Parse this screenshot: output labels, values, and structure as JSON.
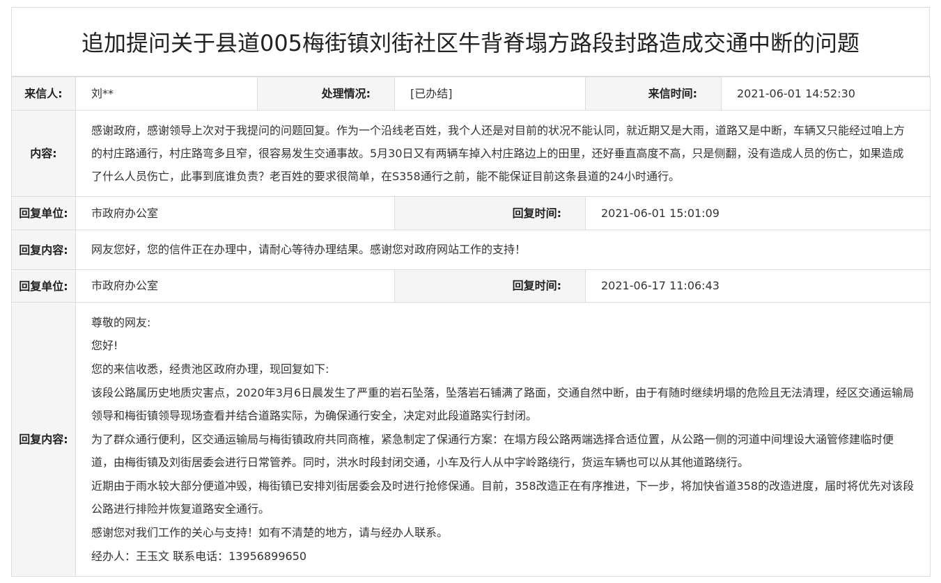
{
  "title": "追加提问关于县道005梅街镇刘街社区牛背脊塌方路段封路造成交通中断的问题",
  "row1": {
    "sender_label": "来信人:",
    "sender_value": "刘**",
    "status_label": "处理情况:",
    "status_value": "[已办结]",
    "time_label": "来信时间:",
    "time_value": "2021-06-01 14:52:30"
  },
  "content": {
    "label": "内容:",
    "text": "感谢政府，感谢领导上次对于我提问的问题回复。作为一个沿线老百姓，我个人还是对目前的状况不能认同，就近期又是大雨，道路又是中断，车辆又只能经过咱上方的村庄路通行，村庄路弯多且窄，很容易发生交通事故。5月30日又有两辆车掉入村庄路边上的田里，还好垂直高度不高，只是侧翻，没有造成人员的伤亡，如果造成了什么人员伤亡，此事到底谁负责？老百姓的要求很简单，在S358通行之前，能不能保证目前这条县道的24小时通行。"
  },
  "reply1": {
    "unit_label": "回复单位:",
    "unit_value": "市政府办公室",
    "time_label": "回复时间:",
    "time_value": "2021-06-01 15:01:09",
    "content_label": "回复内容:",
    "content_text": "网友您好，您的信件正在办理中，请耐心等待办理结果。感谢您对政府网站工作的支持！"
  },
  "reply2": {
    "unit_label": "回复单位:",
    "unit_value": "市政府办公室",
    "time_label": "回复时间:",
    "time_value": "2021-06-17 11:06:43",
    "content_label": "回复内容:",
    "paragraphs": [
      "尊敬的网友:",
      "您好!",
      "您的来信收悉，经贵池区政府办理，现回复如下:",
      "该段公路属历史地质灾害点，2020年3月6日晨发生了严重的岩石坠落，坠落岩石铺满了路面，交通自然中断，由于有随时继续坍塌的危险且无法清理，经区交通运输局领导和梅街镇领导现场查看并结合道路实际，为确保通行安全，决定对此段道路实行封闭。",
      "为了群众通行便利，区交通运输局与梅街镇政府共同商榷，紧急制定了保通行方案：在塌方段公路两端选择合适位置，从公路一侧的河道中间埋设大涵管修建临时便道，由梅街镇及刘街居委会进行日常管养。同时，洪水时段封闭交通，小车及行人从中字岭路绕行，货运车辆也可以从其他道路绕行。",
      "近期由于雨水较大部分便道冲毁，梅街镇已安排刘街居委会及时进行抢修保通。目前，358改造正在有序推进，下一步，将加快省道358的改造进度，届时将优先对该段公路进行排险并恢复道路安全通行。",
      "感谢您对我们工作的关心与支持！如有不清楚的地方，请与经办人联系。",
      "经办人：王玉文 联系电话：13956899650"
    ]
  },
  "colors": {
    "status_green": "#4caf50",
    "border": "#dddddd",
    "label_bg": "#f5f5f5"
  }
}
